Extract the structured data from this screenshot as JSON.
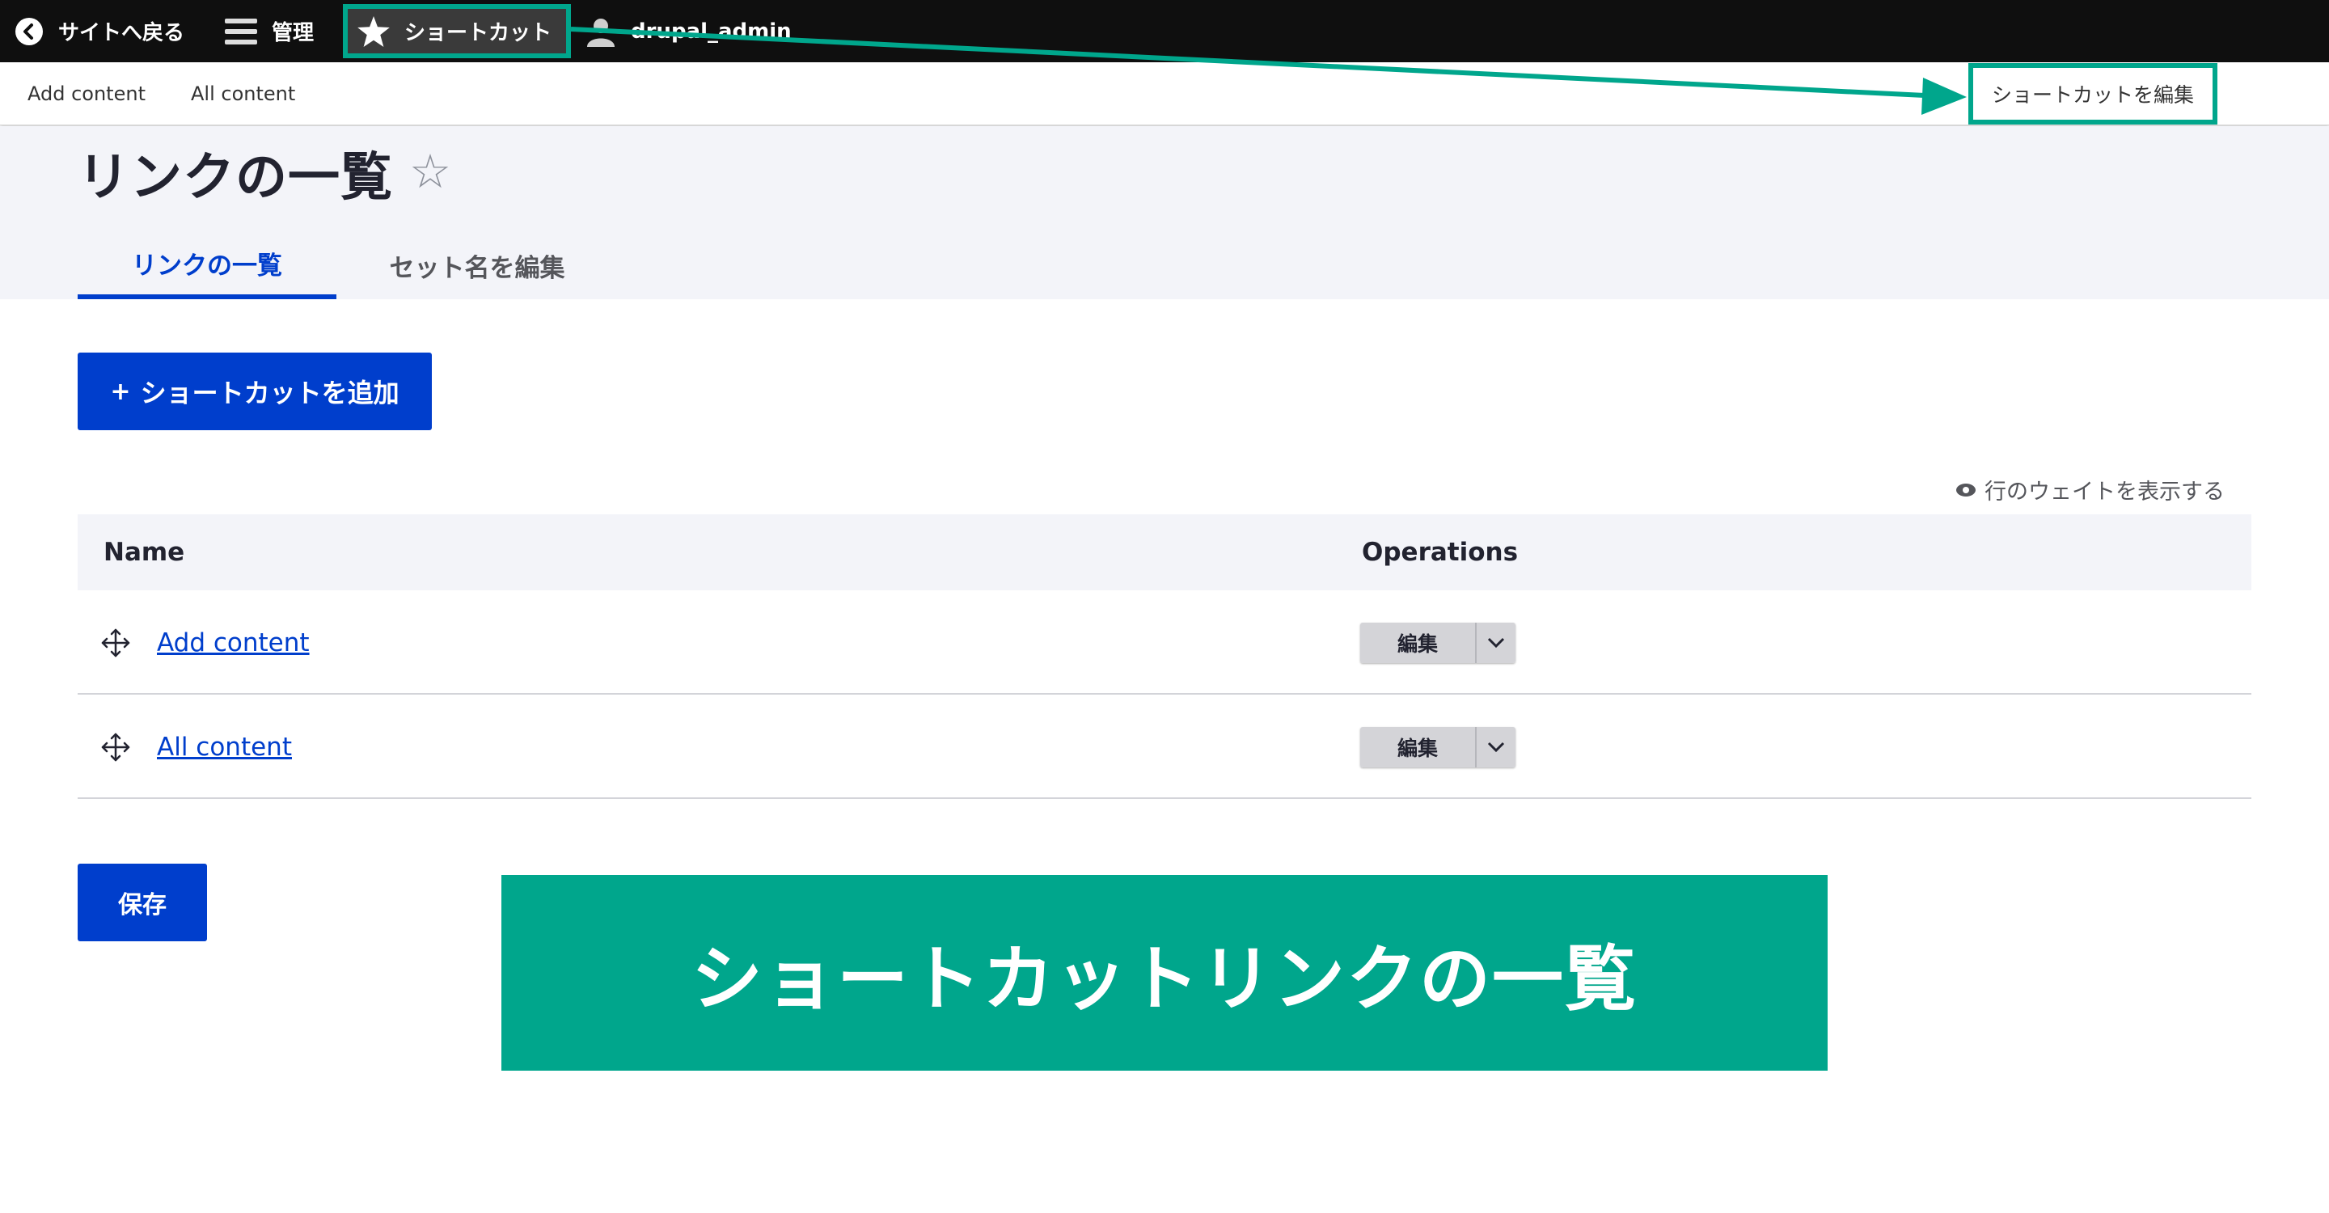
{
  "toolbar": {
    "back": "サイトへ戻る",
    "manage": "管理",
    "shortcuts": "ショートカット",
    "user": "drupal_admin"
  },
  "tray": {
    "links": [
      "Add content",
      "All content"
    ],
    "edit_shortcuts": "ショートカットを編集"
  },
  "page": {
    "title": "リンクの一覧",
    "star": "☆",
    "tabs": [
      "リンクの一覧",
      "セット名を編集"
    ],
    "active_tab": 0
  },
  "add_button": "ショートカットを追加",
  "show_weights": "行のウェイトを表示する",
  "table": {
    "headers": [
      "Name",
      "Operations"
    ],
    "rows": [
      {
        "name": "Add content",
        "operation": "編集"
      },
      {
        "name": "All content",
        "operation": "編集"
      }
    ]
  },
  "save_button": "保存",
  "banner": "ショートカットリンクの一覧",
  "colors": {
    "accent": "#00a68c",
    "primary": "#003ecc",
    "toolbar": "#0f0f0f",
    "header_bg": "#f3f4f9"
  }
}
